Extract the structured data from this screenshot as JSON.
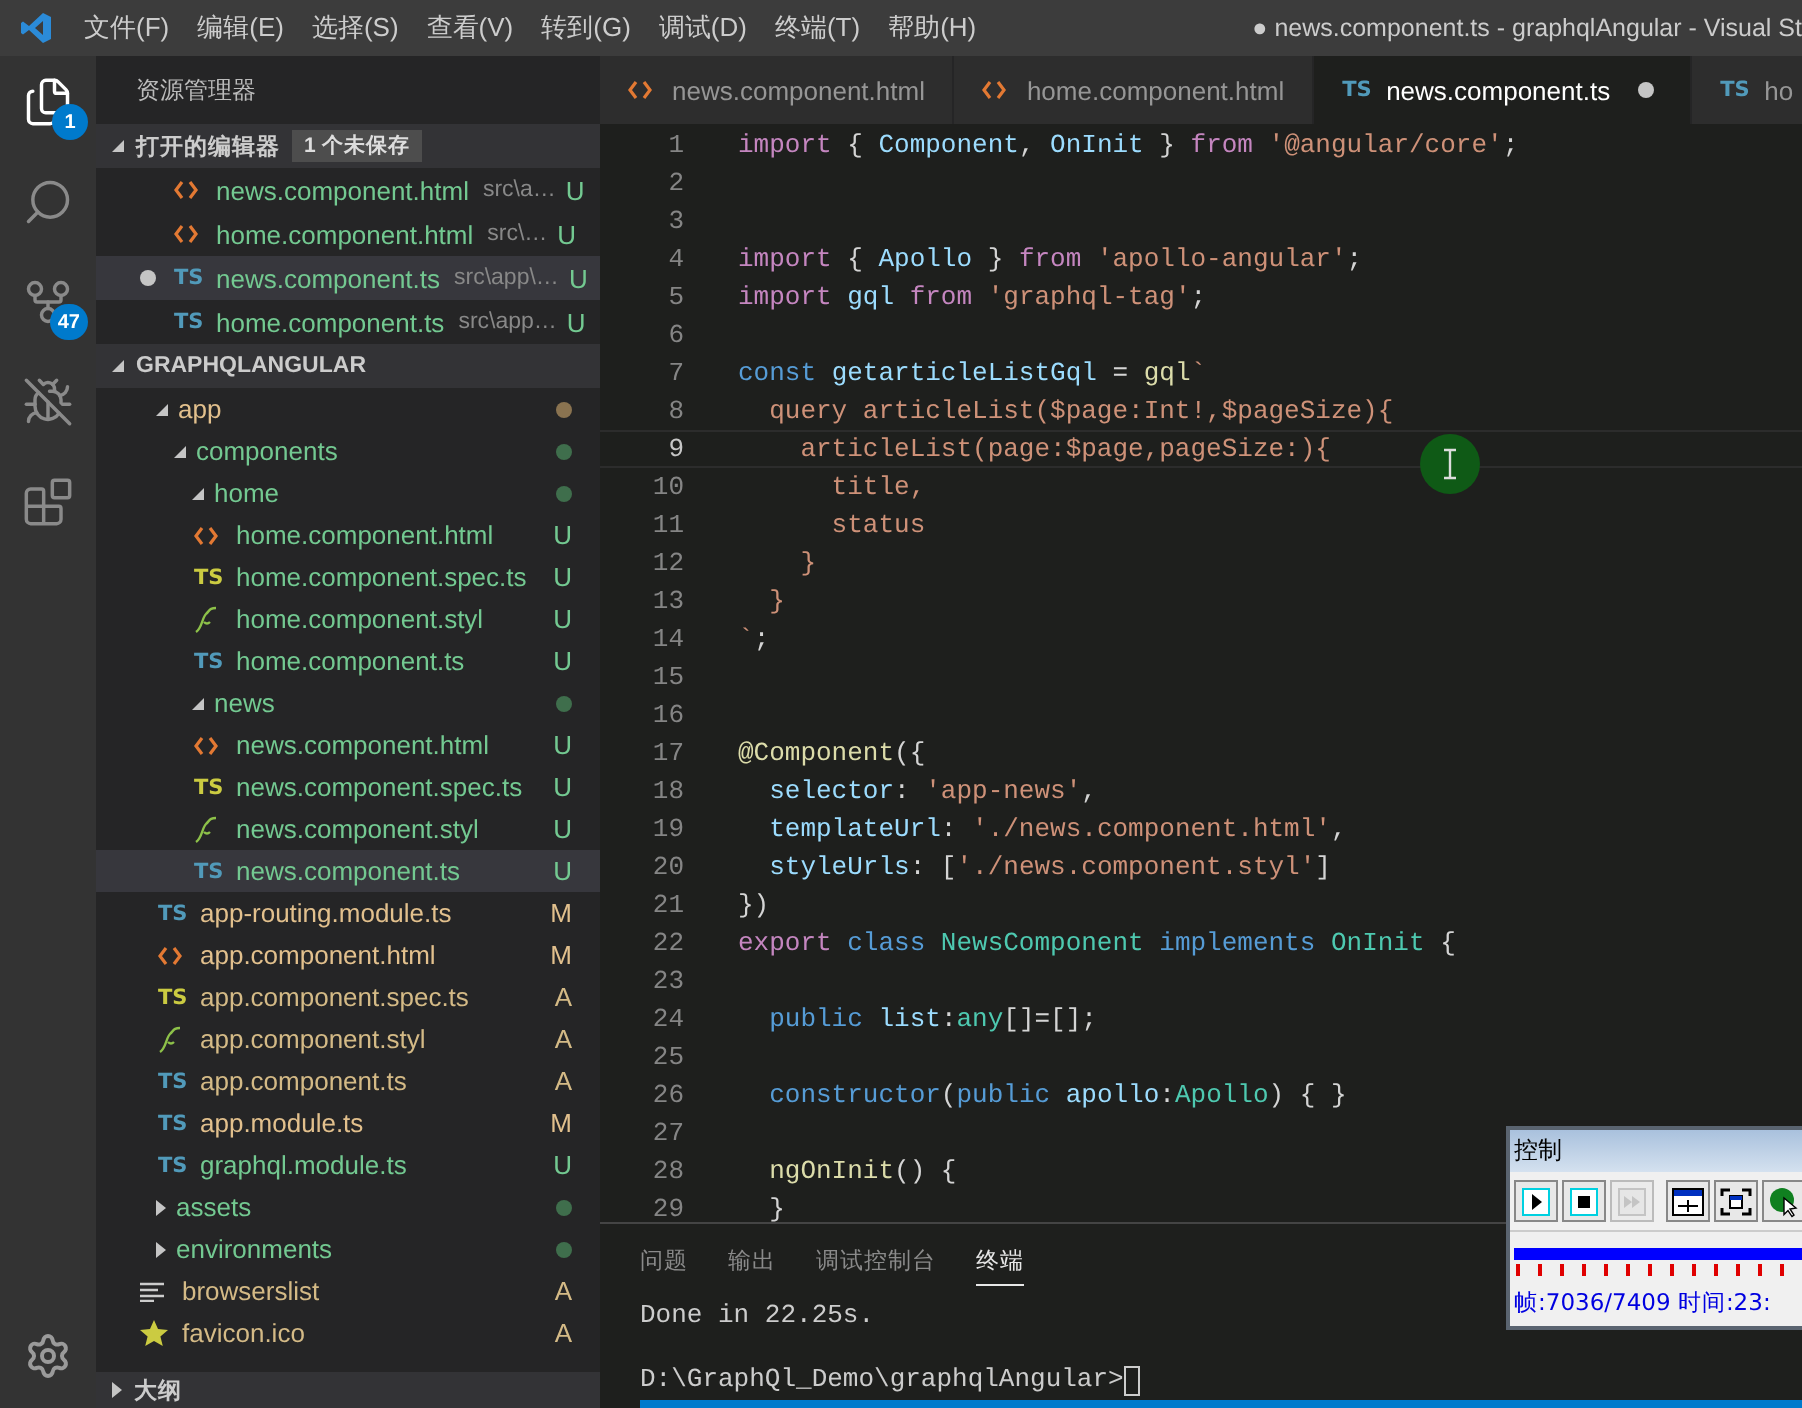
{
  "title_bar": {
    "menu": [
      "文件(F)",
      "编辑(E)",
      "选择(S)",
      "查看(V)",
      "转到(G)",
      "调试(D)",
      "终端(T)",
      "帮助(H)"
    ],
    "title": "● news.component.ts - graphqlAngular - Visual St"
  },
  "activity_bar": [
    {
      "kind": "files",
      "badge": "1",
      "selected": true
    },
    {
      "kind": "search",
      "selected": false
    },
    {
      "kind": "git",
      "badge": "47",
      "selected": false
    },
    {
      "kind": "debug",
      "selected": false
    },
    {
      "kind": "extensions",
      "selected": false
    }
  ],
  "explorer": {
    "title": "资源管理器",
    "open_editors": {
      "label": "打开的编辑器",
      "badge": "1 个未保存",
      "expanded": true,
      "items": [
        {
          "kind": "html",
          "name": "news.component.html",
          "path": "src\\a…",
          "status": "U",
          "color": "#73c991",
          "dirty": false,
          "selected": false
        },
        {
          "kind": "html",
          "name": "home.component.html",
          "path": "src\\…",
          "status": "U",
          "color": "#73c991",
          "dirty": false,
          "selected": false
        },
        {
          "kind": "ts",
          "icon_text": "TS",
          "name": "news.component.ts",
          "path": "src\\app\\…",
          "status": "U",
          "color": "#73c991",
          "dirty": true,
          "selected": true
        },
        {
          "kind": "ts",
          "icon_text": "TS",
          "name": "home.component.ts",
          "path": "src\\app…",
          "status": "U",
          "color": "#73c991",
          "dirty": false,
          "selected": false
        }
      ]
    },
    "project": {
      "label": "GRAPHQLANGULAR",
      "expanded": true,
      "tree": [
        {
          "kind": "folder",
          "name": "app",
          "expanded": true,
          "color": "#8a7350",
          "children": [
            {
              "kind": "folder",
              "name": "components",
              "expanded": true,
              "color": "#3f6e4c",
              "children": [
                {
                  "kind": "folder",
                  "name": "home",
                  "expanded": true,
                  "color": "#3f6e4c",
                  "children": [
                    {
                      "kind": "html",
                      "name": "home.component.html",
                      "status": "U",
                      "color": "#73c991",
                      "selected": false
                    },
                    {
                      "kind": "spec",
                      "icon_text": "TS",
                      "name": "home.component.spec.ts",
                      "status": "U",
                      "color": "#73c991",
                      "selected": false
                    },
                    {
                      "kind": "styl",
                      "name": "home.component.styl",
                      "status": "U",
                      "color": "#73c991",
                      "selected": false
                    },
                    {
                      "kind": "ts",
                      "icon_text": "TS",
                      "name": "home.component.ts",
                      "status": "U",
                      "color": "#73c991",
                      "selected": false
                    }
                  ]
                },
                {
                  "kind": "folder",
                  "name": "news",
                  "expanded": true,
                  "color": "#3f6e4c",
                  "children": [
                    {
                      "kind": "html",
                      "name": "news.component.html",
                      "status": "U",
                      "color": "#73c991",
                      "selected": false
                    },
                    {
                      "kind": "spec",
                      "icon_text": "TS",
                      "name": "news.component.spec.ts",
                      "status": "U",
                      "color": "#73c991",
                      "selected": false
                    },
                    {
                      "kind": "styl",
                      "name": "news.component.styl",
                      "status": "U",
                      "color": "#73c991",
                      "selected": false
                    },
                    {
                      "kind": "ts",
                      "icon_text": "TS",
                      "name": "news.component.ts",
                      "status": "U",
                      "color": "#73c991",
                      "selected": true
                    }
                  ]
                }
              ]
            },
            {
              "kind": "ts",
              "icon_text": "TS",
              "name": "app-routing.module.ts",
              "status": "M",
              "color": "#e2c08d",
              "selected": false
            },
            {
              "kind": "html",
              "name": "app.component.html",
              "status": "M",
              "color": "#e2c08d",
              "selected": false
            },
            {
              "kind": "spec",
              "icon_text": "TS",
              "name": "app.component.spec.ts",
              "status": "A",
              "color": "#d4ba86",
              "selected": false
            },
            {
              "kind": "styl",
              "name": "app.component.styl",
              "status": "A",
              "color": "#d4ba86",
              "selected": false
            },
            {
              "kind": "ts",
              "icon_text": "TS",
              "name": "app.component.ts",
              "status": "A",
              "color": "#d4ba86",
              "selected": false
            },
            {
              "kind": "ts",
              "icon_text": "TS",
              "name": "app.module.ts",
              "status": "M",
              "color": "#e2c08d",
              "selected": false
            },
            {
              "kind": "ts",
              "icon_text": "TS",
              "name": "graphql.module.ts",
              "status": "U",
              "color": "#73c991",
              "selected": false
            }
          ]
        },
        {
          "kind": "folder",
          "name": "assets",
          "expanded": false,
          "color": "#3f6e4c"
        },
        {
          "kind": "folder",
          "name": "environments",
          "expanded": false,
          "color": "#3f6e4c"
        },
        {
          "kind": "list",
          "name": "browserslist",
          "status": "A",
          "color": "#d4ba86",
          "selected": false
        },
        {
          "kind": "star",
          "name": "favicon.ico",
          "status": "A",
          "color": "#d4ba86",
          "selected": false
        }
      ]
    },
    "outline": {
      "label": "大纲",
      "expanded": false
    }
  },
  "tabs": [
    {
      "kind": "html",
      "name": "news.component.html",
      "selected": false,
      "dirty": false
    },
    {
      "kind": "html",
      "name": "home.component.html",
      "selected": false,
      "dirty": false
    },
    {
      "kind": "ts",
      "icon_text": "TS",
      "name": "news.component.ts",
      "selected": true,
      "dirty": true
    },
    {
      "kind": "ts",
      "icon_text": "TS",
      "name": "ho",
      "selected": false,
      "dirty": false
    }
  ],
  "editor": {
    "lines": [
      {
        "number": "1",
        "tokens": [
          {
            "kind": "keyword",
            "text": "import"
          },
          {
            "kind": "punct",
            "text": " { "
          },
          {
            "kind": "variable",
            "text": "Component"
          },
          {
            "kind": "punct",
            "text": ", "
          },
          {
            "kind": "variable",
            "text": "OnInit"
          },
          {
            "kind": "punct",
            "text": " } "
          },
          {
            "kind": "keyword",
            "text": "from "
          },
          {
            "kind": "string",
            "text": "'@angular/core'"
          },
          {
            "kind": "punct",
            "text": ";"
          }
        ]
      },
      {
        "number": "2"
      },
      {
        "number": "3"
      },
      {
        "number": "4",
        "tokens": [
          {
            "kind": "keyword",
            "text": "import"
          },
          {
            "kind": "punct",
            "text": " { "
          },
          {
            "kind": "variable",
            "text": "Apollo"
          },
          {
            "kind": "punct",
            "text": " } "
          },
          {
            "kind": "keyword",
            "text": "from "
          },
          {
            "kind": "string",
            "text": "'apollo-angular'"
          },
          {
            "kind": "punct",
            "text": ";"
          }
        ]
      },
      {
        "number": "5",
        "tokens": [
          {
            "kind": "keyword",
            "text": "import "
          },
          {
            "kind": "variable",
            "text": "gql "
          },
          {
            "kind": "keyword",
            "text": "from "
          },
          {
            "kind": "string",
            "text": "'graphql-tag'"
          },
          {
            "kind": "punct",
            "text": ";"
          }
        ]
      },
      {
        "number": "6"
      },
      {
        "number": "7",
        "tokens": [
          {
            "kind": "storage",
            "text": "const "
          },
          {
            "kind": "variable",
            "text": "getarticleListGql"
          },
          {
            "kind": "punct",
            "text": " = "
          },
          {
            "kind": "function",
            "text": "gql"
          },
          {
            "kind": "string",
            "text": "`"
          }
        ]
      },
      {
        "number": "8",
        "tokens": [
          {
            "kind": "string",
            "text": "  query articleList($page:Int!,$pageSize){"
          }
        ]
      },
      {
        "number": "9",
        "current": true,
        "tokens": [
          {
            "kind": "string",
            "text": "    articleList(page:$page,pageSize:){"
          }
        ]
      },
      {
        "number": "10",
        "tokens": [
          {
            "kind": "string",
            "text": "      title,"
          }
        ]
      },
      {
        "number": "11",
        "tokens": [
          {
            "kind": "string",
            "text": "      status"
          }
        ]
      },
      {
        "number": "12",
        "tokens": [
          {
            "kind": "string",
            "text": "    }"
          }
        ]
      },
      {
        "number": "13",
        "tokens": [
          {
            "kind": "string",
            "text": "  }"
          }
        ]
      },
      {
        "number": "14",
        "tokens": [
          {
            "kind": "string",
            "text": "`"
          },
          {
            "kind": "punct",
            "text": ";"
          }
        ]
      },
      {
        "number": "15"
      },
      {
        "number": "16"
      },
      {
        "number": "17",
        "tokens": [
          {
            "kind": "function",
            "text": "@Component"
          },
          {
            "kind": "punct",
            "text": "({"
          }
        ]
      },
      {
        "number": "18",
        "tokens": [
          {
            "kind": "variable",
            "text": "  selector"
          },
          {
            "kind": "punct",
            "text": ": "
          },
          {
            "kind": "string",
            "text": "'app-news'"
          },
          {
            "kind": "punct",
            "text": ","
          }
        ]
      },
      {
        "number": "19",
        "tokens": [
          {
            "kind": "variable",
            "text": "  templateUrl"
          },
          {
            "kind": "punct",
            "text": ": "
          },
          {
            "kind": "string",
            "text": "'./news.component.html'"
          },
          {
            "kind": "punct",
            "text": ","
          }
        ]
      },
      {
        "number": "20",
        "tokens": [
          {
            "kind": "variable",
            "text": "  styleUrls"
          },
          {
            "kind": "punct",
            "text": ": ["
          },
          {
            "kind": "string",
            "text": "'./news.component.styl'"
          },
          {
            "kind": "punct",
            "text": "]"
          }
        ]
      },
      {
        "number": "21",
        "tokens": [
          {
            "kind": "punct",
            "text": "})"
          }
        ]
      },
      {
        "number": "22",
        "tokens": [
          {
            "kind": "keyword",
            "text": "export "
          },
          {
            "kind": "storage",
            "text": "class "
          },
          {
            "kind": "type",
            "text": "NewsComponent "
          },
          {
            "kind": "storage",
            "text": "implements "
          },
          {
            "kind": "type",
            "text": "OnInit"
          },
          {
            "kind": "punct",
            "text": " {"
          }
        ]
      },
      {
        "number": "23"
      },
      {
        "number": "24",
        "tokens": [
          {
            "kind": "storage",
            "text": "  public "
          },
          {
            "kind": "variable",
            "text": "list"
          },
          {
            "kind": "punct",
            "text": ":"
          },
          {
            "kind": "type",
            "text": "any"
          },
          {
            "kind": "punct",
            "text": "[]=[];"
          }
        ]
      },
      {
        "number": "25"
      },
      {
        "number": "26",
        "tokens": [
          {
            "kind": "storage",
            "text": "  constructor"
          },
          {
            "kind": "punct",
            "text": "("
          },
          {
            "kind": "storage",
            "text": "public "
          },
          {
            "kind": "variable",
            "text": "apollo"
          },
          {
            "kind": "punct",
            "text": ":"
          },
          {
            "kind": "type",
            "text": "Apollo"
          },
          {
            "kind": "punct",
            "text": ") { }"
          }
        ]
      },
      {
        "number": "27"
      },
      {
        "number": "28",
        "tokens": [
          {
            "kind": "function",
            "text": "  ngOnInit"
          },
          {
            "kind": "punct",
            "text": "() {"
          }
        ]
      },
      {
        "number": "29",
        "tokens": [
          {
            "kind": "punct",
            "text": "  }"
          }
        ]
      }
    ]
  },
  "panel": {
    "tabs": [
      {
        "label": "问题",
        "selected": false
      },
      {
        "label": "输出",
        "selected": false
      },
      {
        "label": "调试控制台",
        "selected": false
      },
      {
        "label": "终端",
        "selected": true
      }
    ],
    "output": [
      "Done in 22.25s."
    ],
    "prompt": "D:\\GraphQl_Demo\\graphqlAngular>"
  },
  "control_window": {
    "title": "控制",
    "buttons": [
      {
        "kind": "play",
        "disabled": false
      },
      {
        "kind": "stop",
        "disabled": false
      },
      {
        "kind": "forward",
        "disabled": true
      },
      {
        "kind": "window",
        "disabled": false
      },
      {
        "kind": "fullscreen",
        "disabled": false
      },
      {
        "kind": "pointer",
        "disabled": false
      }
    ],
    "status": "帧:7036/7409 时间:23:"
  }
}
